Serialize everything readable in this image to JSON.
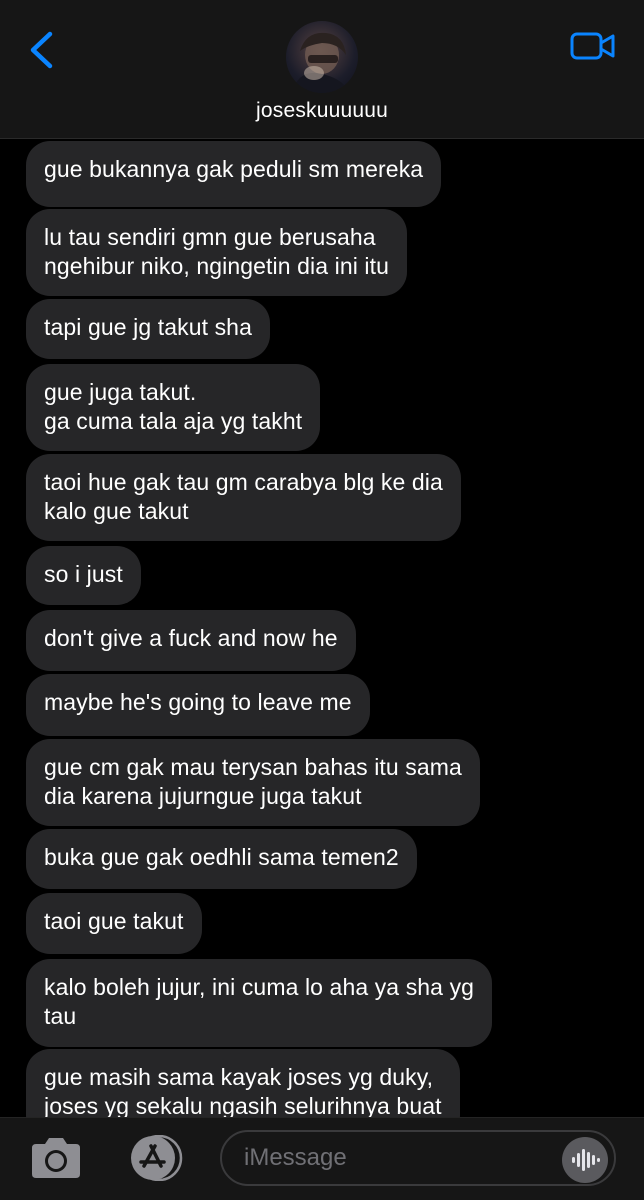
{
  "header": {
    "contact_name": "joseskuuuuuu"
  },
  "colors": {
    "accent": "#0a84ff",
    "bubble": "#262628",
    "header_bg": "#161616",
    "background": "#000000"
  },
  "icons": {
    "back": "chevron-left-icon",
    "video": "video-camera-icon",
    "camera": "camera-icon",
    "apps": "app-store-icon",
    "audio": "audio-waveform-icon"
  },
  "messages": [
    {
      "text": "gue bukannya gak peduli sm mereka"
    },
    {
      "text": "lu tau sendiri gmn gue berusaha\nngehibur niko, ngingetin dia ini itu"
    },
    {
      "text": "tapi gue jg takut sha"
    },
    {
      "text": "gue juga takut.\nga cuma tala aja yg takht"
    },
    {
      "text": "taoi hue gak tau gm  carabya blg ke dia\nkalo gue takut"
    },
    {
      "text": "so i just"
    },
    {
      "text": "don't give a fuck and now he"
    },
    {
      "text": "maybe he's going to leave me"
    },
    {
      "text": "gue cm gak mau terysan bahas itu sama\ndia karena jujurngue juga takut"
    },
    {
      "text": "buka  gue gak oedhli sama temen2"
    },
    {
      "text": "taoi gue takut"
    },
    {
      "text": "kalo boleh jujur, ini cuma lo aha ya sha yg\ntau"
    },
    {
      "text": "gue masih sama kayak joses yg duky,\njoses yg sekalu ngasih selurihnya buat"
    }
  ],
  "composer": {
    "placeholder": "iMessage",
    "value": ""
  }
}
